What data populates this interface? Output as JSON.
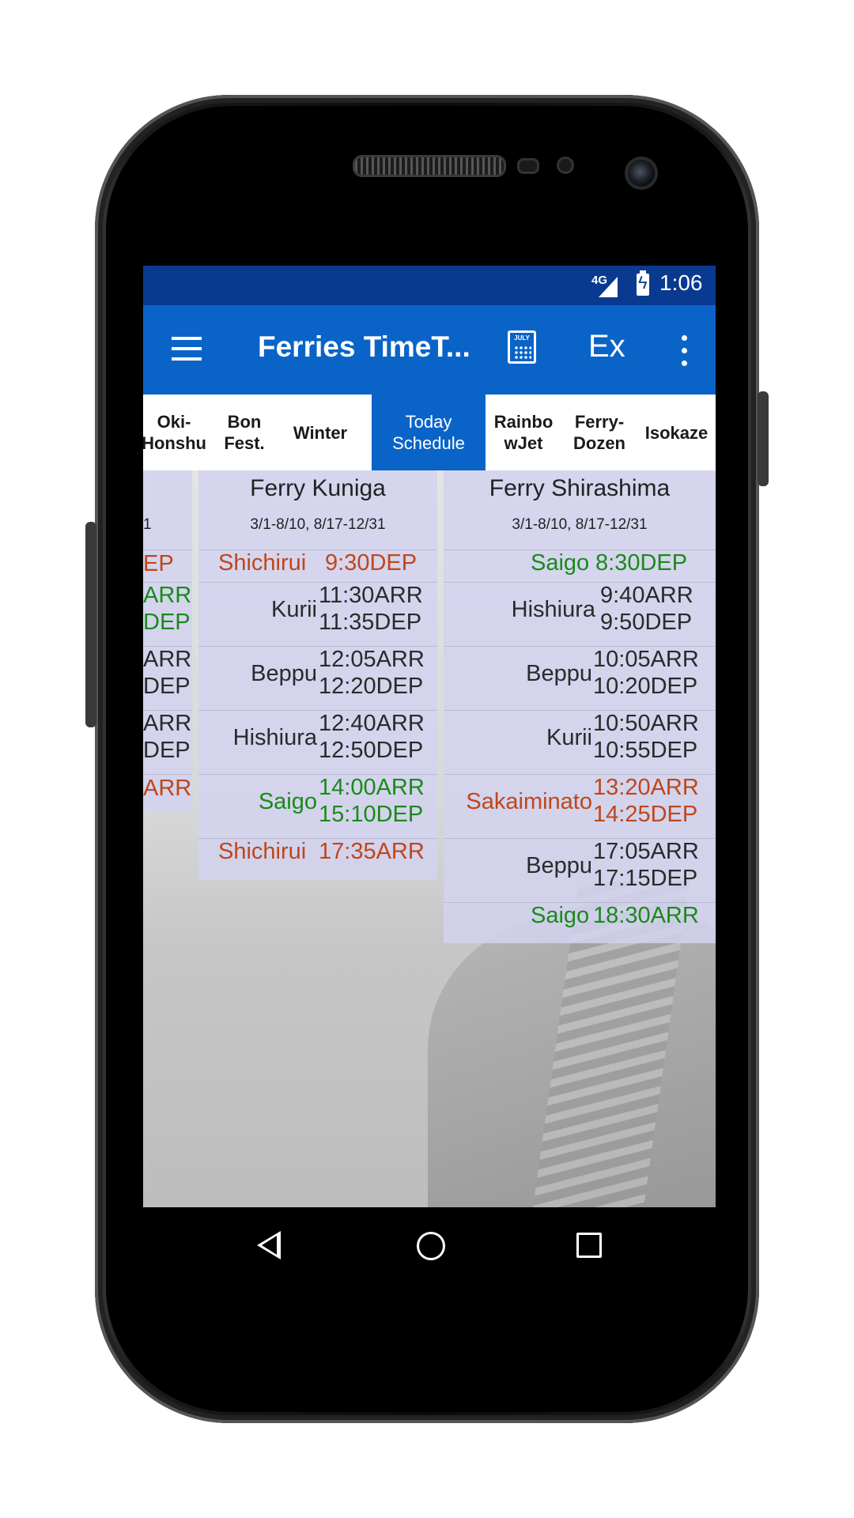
{
  "status_bar": {
    "network": "4G",
    "time": "1:06"
  },
  "app_bar": {
    "title": "Ferries TimeT...",
    "calendar_month": "JULY",
    "ex_label": "Ex"
  },
  "tabs": [
    {
      "label": "Oki-\nHonshu",
      "active": false
    },
    {
      "label": "Bon\nFest.",
      "active": false
    },
    {
      "label": "Winter",
      "active": false
    },
    {
      "label": "Today\nSchedule",
      "active": true
    },
    {
      "label": "Rainbo\nwJet",
      "active": false
    },
    {
      "label": "Ferry-\nDozen",
      "active": false
    },
    {
      "label": "Isokaze",
      "active": false
    }
  ],
  "columns": [
    {
      "name": "",
      "dates": "1",
      "times": [
        "EP",
        "ARR",
        "DEP",
        "ARR",
        "DEP",
        "ARR",
        "DEP",
        "ARR"
      ]
    },
    {
      "name": "Ferry Kuniga",
      "dates": "3/1-8/10, 8/17-12/31",
      "stops": [
        {
          "stop": "Shichirui",
          "times": [
            "9:30DEP"
          ],
          "color": "#c0461a"
        },
        {
          "stop": "Kurii",
          "times": [
            "11:30ARR",
            "11:35DEP"
          ],
          "color": "#2a2a2a"
        },
        {
          "stop": "Beppu",
          "times": [
            "12:05ARR",
            "12:20DEP"
          ],
          "color": "#2a2a2a"
        },
        {
          "stop": "Hishiura",
          "times": [
            "12:40ARR",
            "12:50DEP"
          ],
          "color": "#2a2a2a"
        },
        {
          "stop": "Saigo",
          "times": [
            "14:00ARR",
            "15:10DEP"
          ],
          "color": "#1a8a1a"
        },
        {
          "stop": "Shichirui",
          "times": [
            "17:35ARR"
          ],
          "color": "#c0461a"
        }
      ]
    },
    {
      "name": "Ferry Shirashima",
      "dates": "3/1-8/10, 8/17-12/31",
      "stops": [
        {
          "stop": "Saigo",
          "times": [
            "8:30DEP"
          ],
          "color": "#1a8a1a"
        },
        {
          "stop": "Hishiura",
          "times": [
            "9:40ARR",
            "9:50DEP"
          ],
          "color": "#2a2a2a"
        },
        {
          "stop": "Beppu",
          "times": [
            "10:05ARR",
            "10:20DEP"
          ],
          "color": "#2a2a2a"
        },
        {
          "stop": "Kurii",
          "times": [
            "10:50ARR",
            "10:55DEP"
          ],
          "color": "#2a2a2a"
        },
        {
          "stop": "Sakaiminato",
          "times": [
            "13:20ARR",
            "14:25DEP"
          ],
          "color": "#c0461a"
        },
        {
          "stop": "Beppu",
          "times": [
            "17:05ARR",
            "17:15DEP"
          ],
          "color": "#2a2a2a"
        },
        {
          "stop": "Saigo",
          "times": [
            "18:30ARR"
          ],
          "color": "#1a8a1a"
        }
      ]
    }
  ],
  "colors": {
    "status_bar": "#0a3a8f",
    "app_bar": "#0a64c8",
    "departure_port": "#c0461a",
    "saigo": "#1a8a1a"
  }
}
